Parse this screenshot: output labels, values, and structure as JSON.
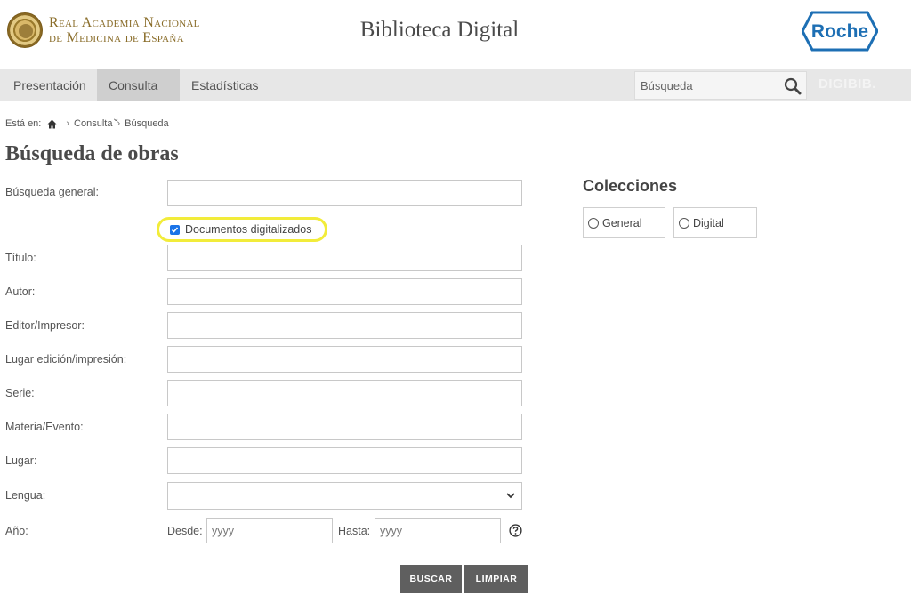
{
  "header": {
    "logo_line1": "Real Academia Nacional",
    "logo_line2": "de Medicina de España",
    "site_title": "Biblioteca Digital",
    "sponsor": "Roche"
  },
  "nav": {
    "items": [
      {
        "label": "Presentación",
        "active": false
      },
      {
        "label": "Consulta",
        "active": true,
        "has_dropdown": true
      },
      {
        "label": "Estadísticas",
        "active": false
      }
    ],
    "search_placeholder": "Búsqueda",
    "brand": "DIGIBIB."
  },
  "breadcrumb": {
    "prefix": "Está en:",
    "items": [
      "Consulta",
      "Búsqueda"
    ]
  },
  "page_title": "Búsqueda de obras",
  "form": {
    "general_label": "Búsqueda general:",
    "digitized_label": "Documentos digitalizados",
    "digitized_checked": true,
    "fields": [
      {
        "label": "Título:"
      },
      {
        "label": "Autor:"
      },
      {
        "label": "Editor/Impresor:"
      },
      {
        "label": "Lugar edición/impresión:"
      },
      {
        "label": "Serie:"
      },
      {
        "label": "Materia/Evento:"
      },
      {
        "label": "Lugar:"
      }
    ],
    "language_label": "Lengua:",
    "language_value": "",
    "year_label": "Año:",
    "from_label": "Desde:",
    "from_placeholder": "yyyy",
    "to_label": "Hasta:",
    "to_placeholder": "yyyy",
    "search_button": "BUSCAR",
    "clear_button": "LIMPIAR"
  },
  "collections": {
    "title": "Colecciones",
    "options": [
      "General",
      "Digital"
    ]
  },
  "colors": {
    "accent_gold": "#8a6d2a",
    "nav_bg": "#e7e7e7",
    "button_bg": "#5f5f5f",
    "highlight": "#f2ec3a",
    "roche_blue": "#1d6fb4"
  }
}
